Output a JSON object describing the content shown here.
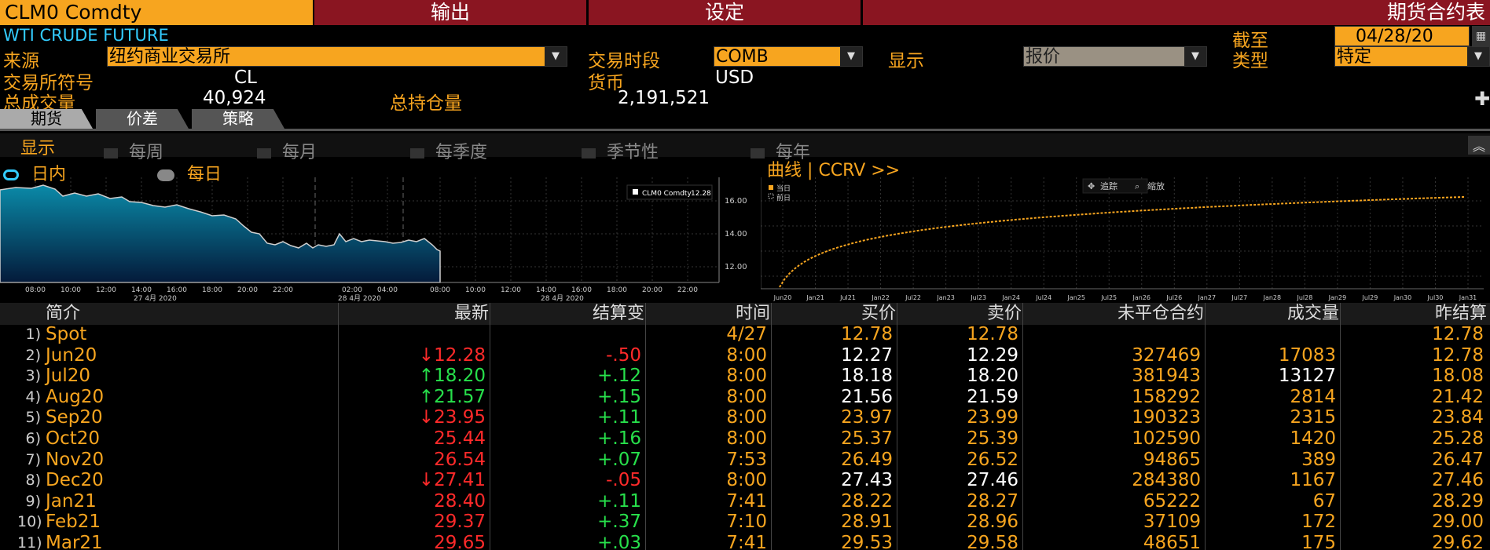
{
  "topbar": {
    "security": "CLM0 Comdty",
    "output": "输出",
    "settings": "设定",
    "title": "期货合约表"
  },
  "desc": "WTI CRUDE FUTURE",
  "fields": {
    "source_label": "来源",
    "source_value": "纽约商业交易所",
    "session_label": "交易时段",
    "session_value": "COMB",
    "display_label": "显示",
    "display_value": "报价",
    "asof_label": "截至",
    "asof_value": "04/28/20",
    "type_label": "类型",
    "type_value": "特定",
    "exch_symbol_label": "交易所符号",
    "exch_symbol_value": "CL",
    "currency_label": "货币",
    "currency_value": "USD",
    "volume_label": "总成交量",
    "volume_value": "40,924",
    "oi_label": "总持仓量",
    "oi_value": "2,191,521"
  },
  "tabs": [
    "期货",
    "价差",
    "策略"
  ],
  "filter": {
    "display": "显示",
    "options": [
      "每周",
      "每月",
      "每季度",
      "季节性",
      "每年"
    ]
  },
  "intraday": {
    "mode_intraday": "日内",
    "mode_daily": "每日",
    "legend": "CLM0 Comdty",
    "legend_value": "12.28",
    "xticks": [
      "08:00",
      "10:00",
      "12:00",
      "14:00",
      "16:00",
      "18:00",
      "20:00",
      "22:00",
      "02:00",
      "04:00",
      "08:00",
      "10:00",
      "12:00",
      "14:00",
      "16:00",
      "18:00",
      "20:00",
      "22:00"
    ],
    "dates": [
      "27 4月 2020",
      "28 4月 2020",
      "28 4月 2020"
    ],
    "yticks": [
      "16.00",
      "14.00",
      "12.00"
    ]
  },
  "curve": {
    "title": "曲线",
    "link": "CCRV >>",
    "legend_current": "当日",
    "legend_prev": "前日",
    "track": "追踪",
    "zoom": "缩放",
    "xticks": [
      "Jun20",
      "Jan21",
      "Jul21",
      "Jan22",
      "Jul22",
      "Jan23",
      "Jul23",
      "Jan24",
      "Jul24",
      "Jan25",
      "Jul25",
      "Jan26",
      "Jul26",
      "Jan27",
      "Jul27",
      "Jan28",
      "Jul28",
      "Jan29",
      "Jul29",
      "Jan30",
      "Jul30",
      "Jan31"
    ]
  },
  "table": {
    "headers": [
      "简介",
      "最新",
      "结算变",
      "时间",
      "买价",
      "卖价",
      "未平仓合约",
      "成交量",
      "昨结算"
    ],
    "rows": [
      {
        "n": "1)",
        "name": "Spot",
        "last": "",
        "dir": "",
        "chg": "",
        "time": "4/27",
        "bid": "12.78",
        "ask": "12.78",
        "oi": "",
        "vol": "",
        "prev": "12.78"
      },
      {
        "n": "2)",
        "name": "Jun20",
        "last": "12.28",
        "dir": "down",
        "chg": "-.50",
        "time": "8:00",
        "bid": "12.27",
        "ask": "12.29",
        "oi": "327469",
        "vol": "17083",
        "prev": "12.78"
      },
      {
        "n": "3)",
        "name": "Jul20",
        "last": "18.20",
        "dir": "up",
        "chg": "+.12",
        "time": "8:00",
        "bid": "18.18",
        "ask": "18.20",
        "oi": "381943",
        "vol": "13127",
        "prev": "18.08"
      },
      {
        "n": "4)",
        "name": "Aug20",
        "last": "21.57",
        "dir": "up",
        "chg": "+.15",
        "time": "8:00",
        "bid": "21.56",
        "ask": "21.59",
        "oi": "158292",
        "vol": "2814",
        "prev": "21.42"
      },
      {
        "n": "5)",
        "name": "Sep20",
        "last": "23.95",
        "dir": "down",
        "chg": "+.11",
        "time": "8:00",
        "bid": "23.97",
        "ask": "23.99",
        "oi": "190323",
        "vol": "2315",
        "prev": "23.84"
      },
      {
        "n": "6)",
        "name": "Oct20",
        "last": "25.44",
        "dir": "",
        "chg": "+.16",
        "time": "8:00",
        "bid": "25.37",
        "ask": "25.39",
        "oi": "102590",
        "vol": "1420",
        "prev": "25.28"
      },
      {
        "n": "7)",
        "name": "Nov20",
        "last": "26.54",
        "dir": "",
        "chg": "+.07",
        "time": "7:53",
        "bid": "26.49",
        "ask": "26.52",
        "oi": "94865",
        "vol": "389",
        "prev": "26.47"
      },
      {
        "n": "8)",
        "name": "Dec20",
        "last": "27.41",
        "dir": "down",
        "chg": "-.05",
        "time": "8:00",
        "bid": "27.43",
        "ask": "27.46",
        "oi": "284380",
        "vol": "1167",
        "prev": "27.46"
      },
      {
        "n": "9)",
        "name": "Jan21",
        "last": "28.40",
        "dir": "",
        "chg": "+.11",
        "time": "7:41",
        "bid": "28.22",
        "ask": "28.27",
        "oi": "65222",
        "vol": "67",
        "prev": "28.29"
      },
      {
        "n": "10)",
        "name": "Feb21",
        "last": "29.37",
        "dir": "",
        "chg": "+.37",
        "time": "7:10",
        "bid": "28.91",
        "ask": "28.96",
        "oi": "37109",
        "vol": "172",
        "prev": "29.00"
      },
      {
        "n": "11)",
        "name": "Mar21",
        "last": "29.65",
        "dir": "",
        "chg": "+.03",
        "time": "7:41",
        "bid": "29.53",
        "ask": "29.58",
        "oi": "48651",
        "vol": "175",
        "prev": "29.62"
      }
    ]
  },
  "colors": {
    "accent": "#f7a51f",
    "header_red": "#8a1521",
    "up": "#27e04b",
    "down": "#ff2a2a",
    "curve": "#f7a51f"
  }
}
